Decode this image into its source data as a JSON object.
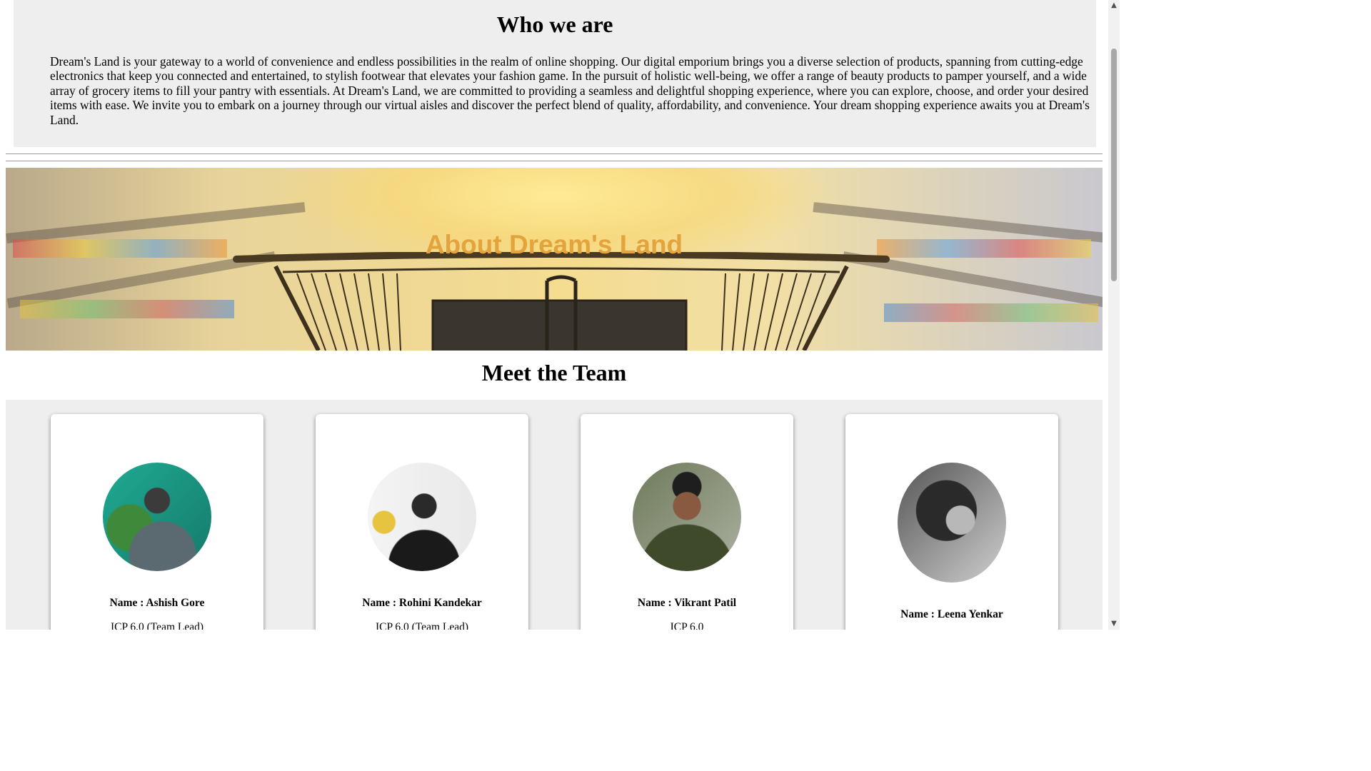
{
  "who_we_are": {
    "heading": "Who we are",
    "body": "Dream's Land is your gateway to a world of convenience and endless possibilities in the realm of online shopping. Our digital emporium brings you a diverse selection of products, spanning from cutting-edge electronics that keep you connected and entertained, to stylish footwear that elevates your fashion game. In the pursuit of holistic well-being, we offer a range of beauty products to pamper yourself, and a wide array of grocery items to fill your pantry with essentials. At Dream's Land, we are committed to providing a seamless and delightful shopping experience, where you can explore, choose, and order your desired items with ease. We invite you to embark on a journey through our virtual aisles and discover the perfect blend of quality, affordability, and convenience. Your dream shopping experience awaits you at Dream's Land."
  },
  "banner": {
    "title": "About Dream's Land",
    "title_color": "#e3a43d"
  },
  "team": {
    "heading": "Meet the Team",
    "members": [
      {
        "name": "Name : Ashish Gore",
        "role": "ICP 6.0 (Team Lead)"
      },
      {
        "name": "Name : Rohini Kandekar",
        "role": "ICP 6.0 (Team Lead)"
      },
      {
        "name": "Name : Vikrant Patil",
        "role": "ICP 6.0"
      },
      {
        "name": "Name : Leena Yenkar",
        "role": ""
      }
    ]
  },
  "colors": {
    "section_bg": "#eeeeee",
    "card_bg": "#ffffff"
  }
}
